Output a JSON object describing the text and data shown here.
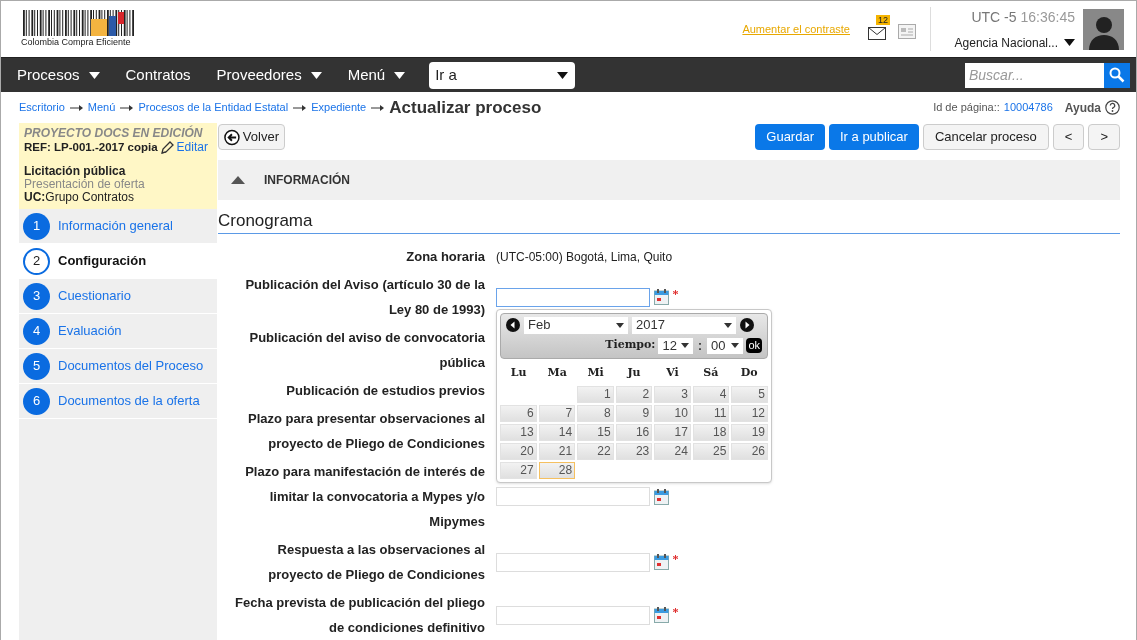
{
  "header": {
    "logo_text": "Colombia Compra Eficiente",
    "contrast_link": "Aumentar el contraste",
    "mail_badge": "12",
    "timezone": "UTC -5",
    "time": "16:36:45",
    "agency": "Agencia Nacional..."
  },
  "nav": {
    "items": [
      {
        "label": "Procesos",
        "dropdown": true
      },
      {
        "label": "Contratos",
        "dropdown": false
      },
      {
        "label": "Proveedores",
        "dropdown": true
      },
      {
        "label": "Menú",
        "dropdown": true
      }
    ],
    "goto": {
      "value": "Ir a"
    },
    "search": {
      "placeholder": "Buscar..."
    }
  },
  "breadcrumb": {
    "links": [
      "Escritorio",
      "Menú",
      "Procesos de la Entidad Estatal",
      "Expediente"
    ],
    "current": "Actualizar proceso"
  },
  "page_id": {
    "label": "Id de página::",
    "value": "10004786"
  },
  "help": "Ayuda",
  "sidebar": {
    "status": "PROYECTO DOCS EN EDICIÓN",
    "ref": "REF: LP-001.-2017 copia",
    "edit": "Editar",
    "type": "Licitación pública",
    "phase": "Presentación de oferta",
    "uc_label": "UC:",
    "uc_value": "Grupo Contratos",
    "steps": [
      {
        "number": "1",
        "label": "Información general",
        "selected": false
      },
      {
        "number": "2",
        "label": "Configuración",
        "selected": true
      },
      {
        "number": "3",
        "label": "Cuestionario",
        "selected": false
      },
      {
        "number": "4",
        "label": "Evaluación",
        "selected": false
      },
      {
        "number": "5",
        "label": "Documentos del Proceso",
        "selected": false
      },
      {
        "number": "6",
        "label": "Documentos de la oferta",
        "selected": false
      }
    ]
  },
  "toolbar": {
    "back": "Volver",
    "actions": [
      {
        "label": "Guardar",
        "kind": "primary"
      },
      {
        "label": "Ir a publicar",
        "kind": "primary"
      },
      {
        "label": "Cancelar proceso",
        "kind": "secondary"
      },
      {
        "label": "<",
        "kind": "secondary"
      },
      {
        "label": ">",
        "kind": "secondary"
      }
    ]
  },
  "section_bar": {
    "label": "INFORMACIÓN"
  },
  "schedule": {
    "title": "Cronograma",
    "rows": [
      {
        "label": "Zona horaria",
        "value": "(UTC-05:00) Bogotá, Lima, Quito"
      },
      {
        "label": "Publicación del Aviso (artículo 30 de la Ley 80 de 1993)",
        "field": {
          "focused": true,
          "required": true
        }
      },
      {
        "label": "Publicación del aviso de convocatoria pública"
      },
      {
        "label": "Publicación de estudios previos"
      },
      {
        "label": "Plazo para presentar observaciones al proyecto de Pliego de Condiciones"
      },
      {
        "label": "Plazo para manifestación de interés de limitar la convocatoria a Mypes y/o Mipymes",
        "field": {
          "focused": false,
          "required": false
        }
      },
      {
        "label": "Respuesta a las observaciones al proyecto de Pliego de Condiciones",
        "field": {
          "focused": false,
          "required": true
        }
      },
      {
        "label": "Fecha prevista de publicación del pliego de condiciones definitivo",
        "field": {
          "focused": false,
          "required": true
        }
      }
    ]
  },
  "date_picker": {
    "month": "Feb",
    "year": "2017",
    "time_label": "Tiempo:",
    "hour": "12",
    "separator": ":",
    "minute": "00",
    "ok": "ok",
    "weekdays": [
      "Lu",
      "Ma",
      "Mi",
      "Ju",
      "Vi",
      "Sá",
      "Do"
    ],
    "weeks": [
      [
        {
          "label": "1",
          "selected": false
        },
        {
          "label": "2",
          "selected": false
        },
        {
          "label": "3",
          "selected": false
        },
        {
          "label": "4",
          "selected": false
        },
        {
          "label": "5",
          "selected": false
        }
      ],
      [
        {
          "label": "6",
          "selected": false
        },
        {
          "label": "7",
          "selected": false
        },
        {
          "label": "8",
          "selected": false
        },
        {
          "label": "9",
          "selected": false
        },
        {
          "label": "10",
          "selected": false
        },
        {
          "label": "11",
          "selected": false
        },
        {
          "label": "12",
          "selected": false
        }
      ],
      [
        {
          "label": "13",
          "selected": false
        },
        {
          "label": "14",
          "selected": false
        },
        {
          "label": "15",
          "selected": false
        },
        {
          "label": "16",
          "selected": false
        },
        {
          "label": "17",
          "selected": false
        },
        {
          "label": "18",
          "selected": false
        },
        {
          "label": "19",
          "selected": false
        }
      ],
      [
        {
          "label": "20",
          "selected": false
        },
        {
          "label": "21",
          "selected": false
        },
        {
          "label": "22",
          "selected": false
        },
        {
          "label": "23",
          "selected": false
        },
        {
          "label": "24",
          "selected": false
        },
        {
          "label": "25",
          "selected": false
        },
        {
          "label": "26",
          "selected": false
        }
      ],
      [
        {
          "label": "27",
          "selected": false
        },
        {
          "label": "28",
          "selected": true
        }
      ]
    ]
  }
}
